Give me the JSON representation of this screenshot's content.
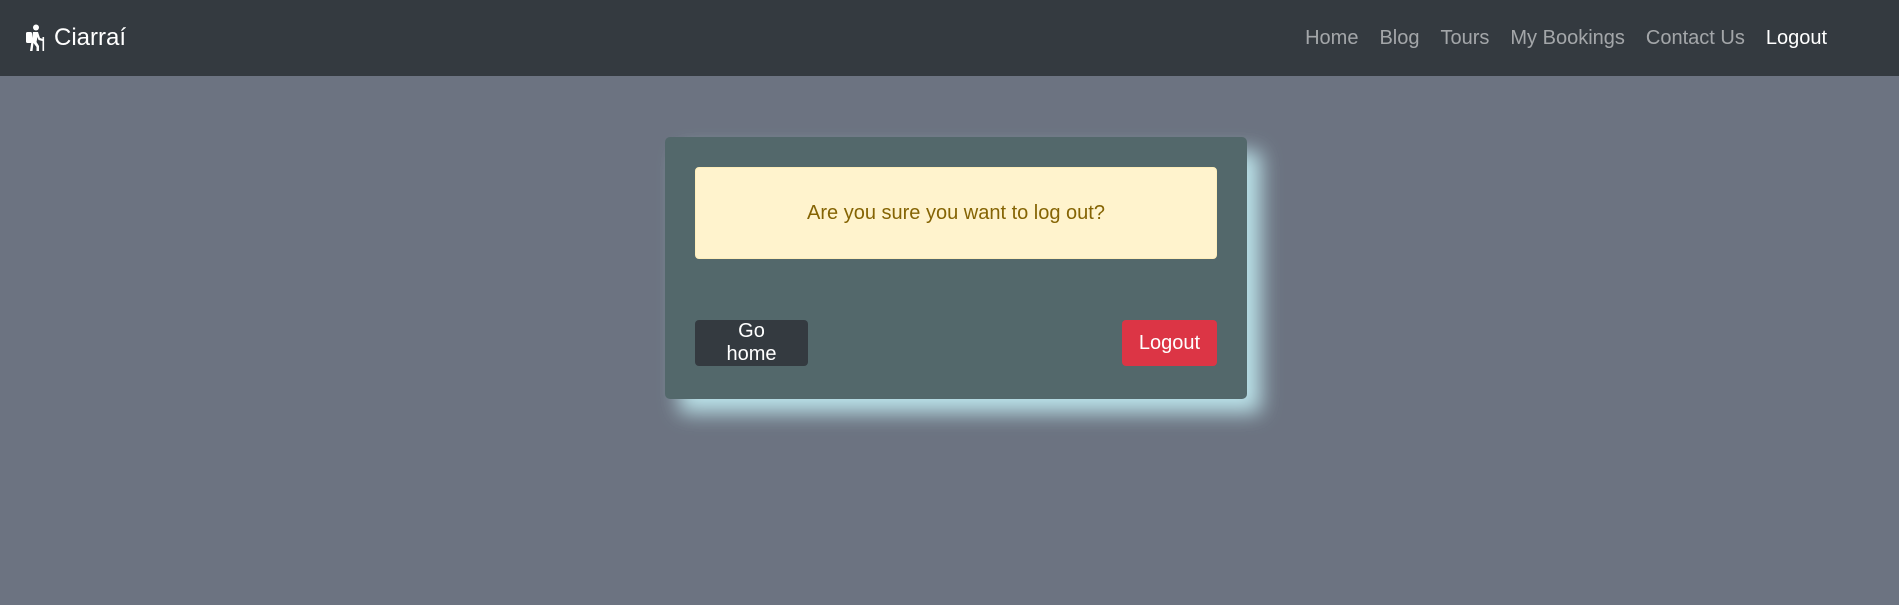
{
  "navbar": {
    "brand": {
      "icon": "hiking-person-icon",
      "label": "Ciarraí"
    },
    "links": [
      {
        "label": "Home",
        "active": false
      },
      {
        "label": "Blog",
        "active": false
      },
      {
        "label": "Tours",
        "active": false
      },
      {
        "label": "My Bookings",
        "active": false
      },
      {
        "label": "Contact Us",
        "active": false
      },
      {
        "label": "Logout",
        "active": true
      }
    ]
  },
  "logout_card": {
    "message": "Are you sure you want to log out?",
    "go_home_label": "Go home",
    "logout_label": "Logout"
  },
  "colors": {
    "navbar_bg": "#343a40",
    "page_bg": "#6c7381",
    "card_bg": "#53686b",
    "alert_bg": "#fff3cd",
    "alert_text": "#856404",
    "danger": "#dc3545",
    "dark": "#343a40"
  }
}
